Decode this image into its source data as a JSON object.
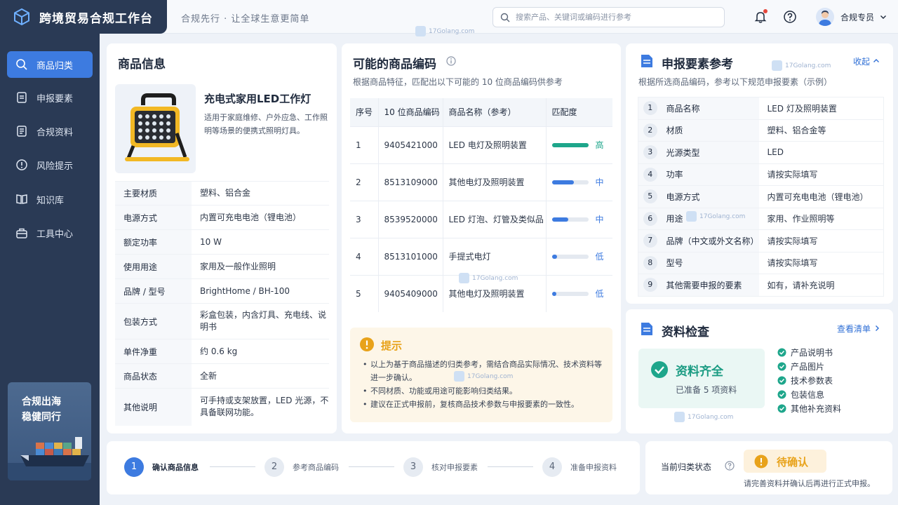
{
  "app": {
    "title": "跨境贸易合规工作台",
    "slogan": "合规先行 · 让全球生意更简单"
  },
  "search": {
    "placeholder": "搜索产品、关键词或编码进行参考"
  },
  "user": {
    "name": "合规专员"
  },
  "sidebar": {
    "items": [
      {
        "label": "商品归类",
        "icon": "search-icon",
        "active": true
      },
      {
        "label": "申报要素",
        "icon": "document-icon"
      },
      {
        "label": "合规资料",
        "icon": "file-icon"
      },
      {
        "label": "风险提示",
        "icon": "alert-icon"
      },
      {
        "label": "知识库",
        "icon": "book-icon"
      },
      {
        "label": "工具中心",
        "icon": "toolbox-icon"
      }
    ],
    "promo": {
      "line1": "合规出海",
      "line2": "稳健同行"
    }
  },
  "product": {
    "section_title": "商品信息",
    "name": "充电式家用LED工作灯",
    "desc": "适用于家庭维修、户外应急、工作照明等场景的便携式照明灯具。",
    "attributes": [
      {
        "key": "主要材质",
        "value": "塑料、铝合金"
      },
      {
        "key": "电源方式",
        "value": "内置可充电电池（锂电池）"
      },
      {
        "key": "额定功率",
        "value": "10 W"
      },
      {
        "key": "使用用途",
        "value": "家用及一般作业照明"
      },
      {
        "key": "品牌 / 型号",
        "value": "BrightHome / BH-100"
      },
      {
        "key": "包装方式",
        "value": "彩盒包装，内含灯具、充电线、说明书"
      },
      {
        "key": "单件净重",
        "value": "约 0.6 kg"
      },
      {
        "key": "商品状态",
        "value": "全新"
      },
      {
        "key": "其他说明",
        "value": "可手持或支架放置，LED 光源，不具备联网功能。"
      }
    ]
  },
  "codes": {
    "title": "可能的商品编码",
    "subtitle": "根据商品特征，匹配出以下可能的 10 位商品编码供参考",
    "headers": [
      "序号",
      "10 位商品编码",
      "商品名称（参考）",
      "匹配度"
    ],
    "rows": [
      {
        "no": "1",
        "code": "9405421000",
        "name": "LED 电灯及照明装置",
        "match": 1.0,
        "level": "高",
        "color": "#1ea68b"
      },
      {
        "no": "2",
        "code": "8513109000",
        "name": "其他电灯及照明装置",
        "match": 0.6,
        "level": "中",
        "color": "#3d7be0"
      },
      {
        "no": "3",
        "code": "8539520000",
        "name": "LED 灯泡、灯管及类似品",
        "match": 0.45,
        "level": "中",
        "color": "#3d7be0"
      },
      {
        "no": "4",
        "code": "8513101000",
        "name": "手提式电灯",
        "match": 0.15,
        "level": "低",
        "color": "#3d7be0"
      },
      {
        "no": "5",
        "code": "9405409000",
        "name": "其他电灯及照明装置",
        "match": 0.12,
        "level": "低",
        "color": "#3d7be0"
      }
    ]
  },
  "tip": {
    "title": "提示",
    "items": [
      "以上为基于商品描述的归类参考，需结合商品实际情况、技术资料等进一步确认。",
      "不同材质、功能或用途可能影响归类结果。",
      "建议在正式申报前，复核商品技术参数与申报要素的一致性。"
    ]
  },
  "declaration": {
    "title": "申报要素参考",
    "collapse": "收起",
    "subtitle": "根据所选商品编码，参考以下规范申报要素（示例）",
    "rows": [
      {
        "no": "1",
        "key": "商品名称",
        "value": "LED 灯及照明装置"
      },
      {
        "no": "2",
        "key": "材质",
        "value": "塑料、铝合金等"
      },
      {
        "no": "3",
        "key": "光源类型",
        "value": "LED"
      },
      {
        "no": "4",
        "key": "功率",
        "value": "请按实际填写"
      },
      {
        "no": "5",
        "key": "电源方式",
        "value": "内置可充电电池（锂电池）"
      },
      {
        "no": "6",
        "key": "用途",
        "value": "家用、作业照明等"
      },
      {
        "no": "7",
        "key": "品牌（中文或外文名称）",
        "value": "请按实际填写"
      },
      {
        "no": "8",
        "key": "型号",
        "value": "请按实际填写"
      },
      {
        "no": "9",
        "key": "其他需要申报的要素",
        "value": "如有，请补充说明"
      }
    ]
  },
  "check": {
    "title": "资料检查",
    "link": "查看清单",
    "status": "资料齐全",
    "prepared": "已准备 5 项资料",
    "items": [
      "产品说明书",
      "产品图片",
      "技术参数表",
      "包装信息",
      "其他补充资料"
    ]
  },
  "steps": [
    {
      "num": "1",
      "label": "确认商品信息",
      "active": true
    },
    {
      "num": "2",
      "label": "参考商品编码"
    },
    {
      "num": "3",
      "label": "核对申报要素"
    },
    {
      "num": "4",
      "label": "准备申报资料"
    }
  ],
  "status": {
    "label": "当前归类状态",
    "badge": "待确认",
    "note": "请完善资料并确认后再进行正式申报。"
  },
  "watermark": "17Golang.com",
  "colors": {
    "primary": "#3d7be0",
    "sidebar": "#2a3a55",
    "success": "#1ea68b",
    "warning": "#e8a21a"
  }
}
